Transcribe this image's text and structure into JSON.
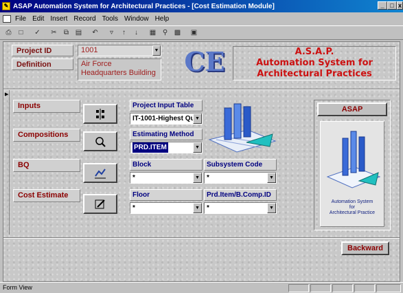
{
  "window": {
    "title": "ASAP Automation System for Architectural Practices - [Cost Estimation Module]",
    "controls": [
      "_",
      "□",
      "x"
    ]
  },
  "menu": [
    "File",
    "Edit",
    "Insert",
    "Record",
    "Tools",
    "Window",
    "Help"
  ],
  "header": {
    "project_id_label": "Project ID",
    "project_id_value": "1001",
    "definition_label": "Definition",
    "definition_value": "Air Force Headquarters Building",
    "logo": "CE",
    "brand_line1": "A.S.A.P.",
    "brand_line2": "Automation System for",
    "brand_line3": "Architectural Practices"
  },
  "sidebar": {
    "items": [
      {
        "label": "Inputs"
      },
      {
        "label": "Compositions"
      },
      {
        "label": "BQ"
      },
      {
        "label": "Cost Estimate"
      }
    ]
  },
  "fields": {
    "project_input_table_label": "Project Input Table",
    "project_input_table_value": "IT-1001-Highest Qu",
    "estimating_method_label": "Estimating Method",
    "estimating_method_value": "PRD.ITEM",
    "block_label": "Block",
    "block_value": "*",
    "subsystem_code_label": "Subsystem Code",
    "subsystem_code_value": "*",
    "floor_label": "Floor",
    "floor_value": "*",
    "prd_item_label": "Prd.Item/B.Comp.ID",
    "prd_item_value": "*"
  },
  "asap_panel": {
    "button_label": "ASAP",
    "caption_line1": "Automation System",
    "caption_line2": "for",
    "caption_line3": "Architectural Practice"
  },
  "backward_label": "Backward",
  "status": "Form View",
  "colors": {
    "accent": "#8b0000",
    "field_label": "#000080",
    "brand": "#cc1111",
    "logo": "#5b78c8"
  }
}
